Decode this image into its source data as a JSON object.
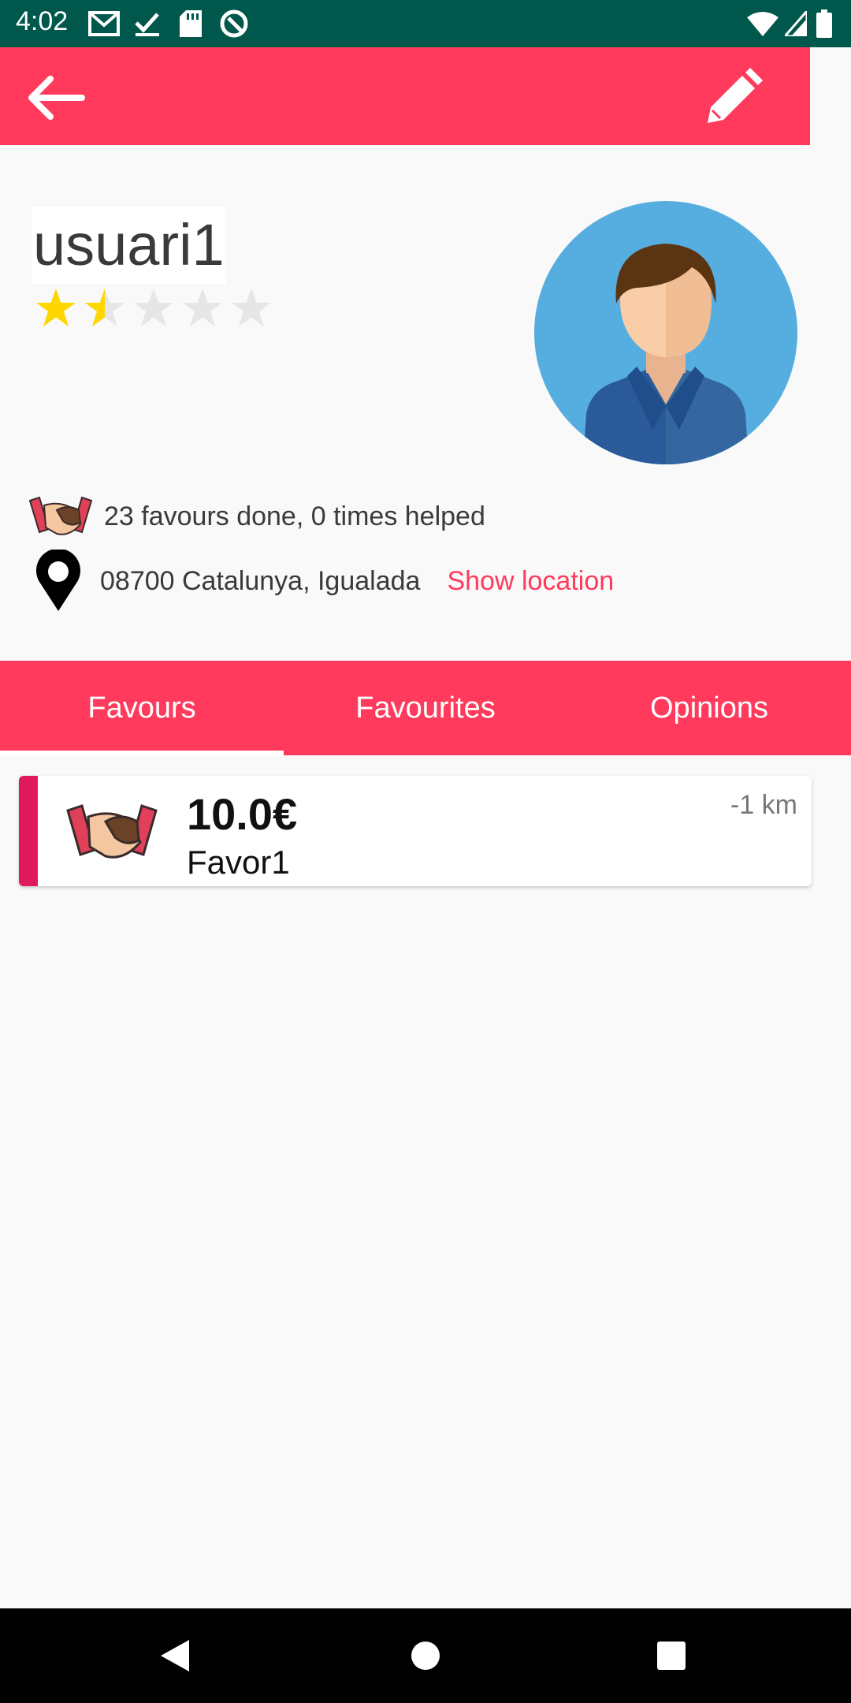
{
  "status_bar": {
    "time": "4:02",
    "background": "#00574b"
  },
  "app_bar": {
    "color": "#ff3a5c",
    "back_icon": "arrow-back-icon",
    "edit_icon": "pencil-icon"
  },
  "profile": {
    "username": "usuari1",
    "rating": 1.5,
    "rating_max": 5,
    "stats": "23 favours done, 0 times helped",
    "location": "08700 Catalunya, Igualada",
    "show_location_label": "Show location"
  },
  "tabs": [
    {
      "label": "Favours",
      "active": true
    },
    {
      "label": "Favourites",
      "active": false
    },
    {
      "label": "Opinions",
      "active": false
    }
  ],
  "favours": [
    {
      "price": "10.0€",
      "title": "Favor1",
      "distance": "-1 km",
      "icon": "handshake-icon"
    }
  ],
  "colors": {
    "accent": "#ff3a5c",
    "card_stripe": "#e0195c",
    "star": "#ffd700"
  }
}
